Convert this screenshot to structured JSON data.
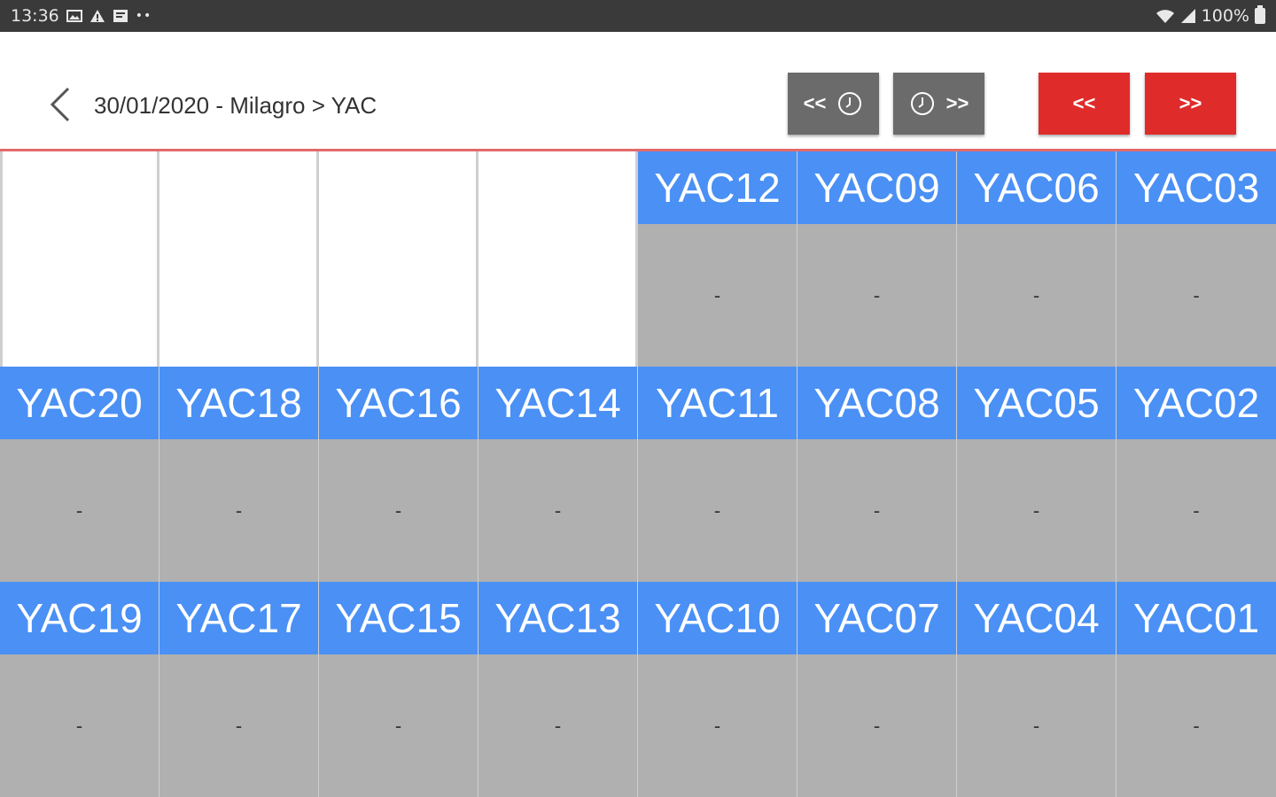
{
  "status_bar": {
    "time": "13:36",
    "battery_percent": "100%",
    "icons": [
      "image-icon",
      "warning-icon",
      "app-icon",
      "more-icon"
    ],
    "right_icons": [
      "wifi-icon",
      "signal-icon",
      "battery-icon"
    ]
  },
  "header": {
    "breadcrumb": "30/01/2020 - Milagro > YAC",
    "buttons": {
      "prev_time_arrows": "<<",
      "next_time_arrows": ">>",
      "prev_label": "<<",
      "next_label": ">>"
    }
  },
  "colors": {
    "label_blue": "#4a90f5",
    "value_gray": "#b0b0b0",
    "button_gray": "#6b6b6b",
    "button_red": "#e02b2b"
  },
  "grid": {
    "rows": [
      {
        "empty_count": 4,
        "cells": [
          {
            "label": "YAC12",
            "value": "-"
          },
          {
            "label": "YAC09",
            "value": "-"
          },
          {
            "label": "YAC06",
            "value": "-"
          },
          {
            "label": "YAC03",
            "value": "-"
          }
        ]
      },
      {
        "empty_count": 0,
        "cells": [
          {
            "label": "YAC20",
            "value": "-"
          },
          {
            "label": "YAC18",
            "value": "-"
          },
          {
            "label": "YAC16",
            "value": "-"
          },
          {
            "label": "YAC14",
            "value": "-"
          },
          {
            "label": "YAC11",
            "value": "-"
          },
          {
            "label": "YAC08",
            "value": "-"
          },
          {
            "label": "YAC05",
            "value": "-"
          },
          {
            "label": "YAC02",
            "value": "-"
          }
        ]
      },
      {
        "empty_count": 0,
        "cells": [
          {
            "label": "YAC19",
            "value": "-"
          },
          {
            "label": "YAC17",
            "value": "-"
          },
          {
            "label": "YAC15",
            "value": "-"
          },
          {
            "label": "YAC13",
            "value": "-"
          },
          {
            "label": "YAC10",
            "value": "-"
          },
          {
            "label": "YAC07",
            "value": "-"
          },
          {
            "label": "YAC04",
            "value": "-"
          },
          {
            "label": "YAC01",
            "value": "-"
          }
        ]
      }
    ]
  }
}
